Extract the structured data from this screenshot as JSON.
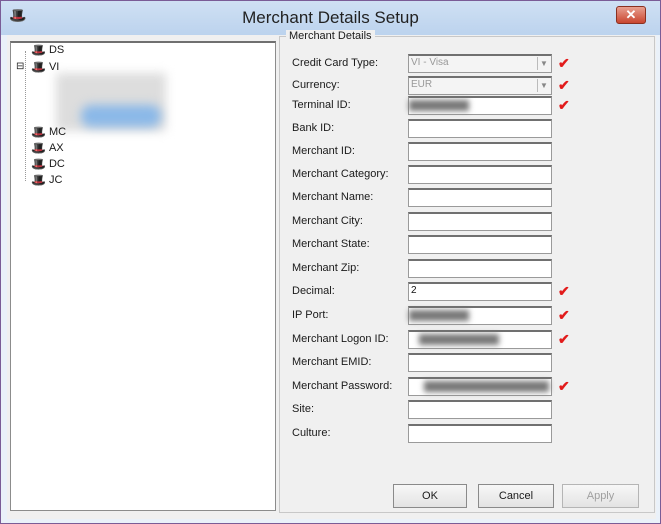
{
  "window": {
    "title": "Merchant Details Setup",
    "close": "✕"
  },
  "tree": {
    "nodes": [
      "DS",
      "VI",
      "MC",
      "AX",
      "DC",
      "JC"
    ],
    "expander": "⊟"
  },
  "group": {
    "title": "Merchant Details"
  },
  "fields": [
    {
      "label": "Credit Card Type:",
      "value": "VI - Visa",
      "type": "dropdown",
      "required": true
    },
    {
      "label": "Currency:",
      "value": "EUR",
      "type": "dropdown",
      "required": true
    },
    {
      "label": "Terminal ID:",
      "value": "",
      "type": "blurred",
      "required": true
    },
    {
      "label": "Bank ID:",
      "value": ""
    },
    {
      "label": "Merchant ID:",
      "value": ""
    },
    {
      "label": "Merchant Category:",
      "value": ""
    },
    {
      "label": "Merchant Name:",
      "value": ""
    },
    {
      "label": "Merchant City:",
      "value": ""
    },
    {
      "label": "Merchant State:",
      "value": ""
    },
    {
      "label": "Merchant Zip:",
      "value": ""
    },
    {
      "label": "Decimal:",
      "value": "2",
      "required": true
    },
    {
      "label": "IP Port:",
      "value": "",
      "type": "blurred",
      "required": true
    },
    {
      "label": "Merchant Logon ID:",
      "value": "",
      "type": "blurred",
      "required": true
    },
    {
      "label": "Merchant EMID:",
      "value": ""
    },
    {
      "label": "Merchant Password:",
      "value": "",
      "type": "blurred",
      "required": true
    },
    {
      "label": "Site:",
      "value": ""
    },
    {
      "label": "Culture:",
      "value": ""
    }
  ],
  "check": "✔",
  "buttons": {
    "ok": "OK",
    "cancel": "Cancel",
    "apply": "Apply"
  },
  "colors": {
    "required": "#e21b1b"
  }
}
